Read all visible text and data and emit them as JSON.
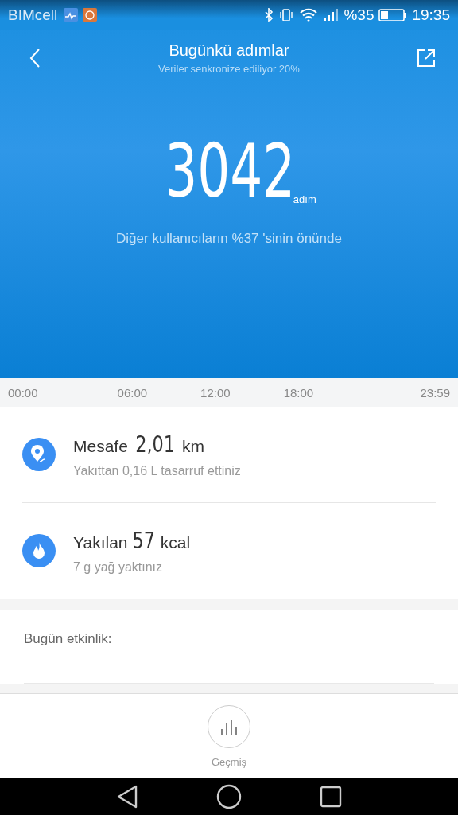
{
  "status_bar": {
    "carrier": "BIMcell",
    "battery": "%35",
    "time": "19:35"
  },
  "header": {
    "title": "Bugünkü adımlar",
    "subtitle": "Veriler senkronize ediliyor 20%"
  },
  "steps": {
    "count": "3042",
    "unit": "adım",
    "comparison": "Diğer kullanıcıların %37 'sinin önünde"
  },
  "timeline": [
    "00:00",
    "06:00",
    "12:00",
    "18:00",
    "23:59"
  ],
  "stats": [
    {
      "kind": "distance",
      "label": "Mesafe",
      "value": "2,01",
      "unit": "km",
      "note": "Yakıttan 0,16 L tasarruf ettiniz"
    },
    {
      "kind": "calories",
      "label": "Yakılan",
      "value": "57",
      "unit": "kcal",
      "note": "7 g yağ yaktınız"
    }
  ],
  "activity": {
    "title": "Bugün etkinlik:"
  },
  "bottom": {
    "label": "Geçmiş"
  }
}
